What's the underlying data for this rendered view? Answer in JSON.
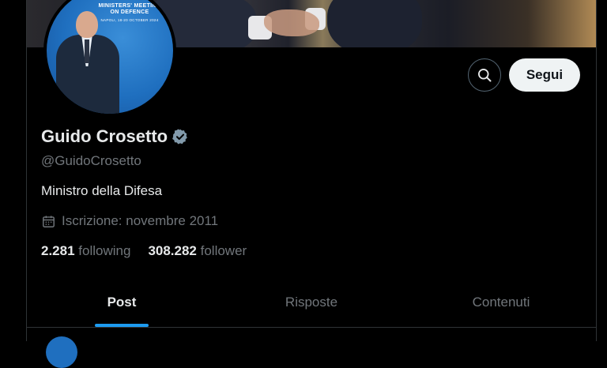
{
  "banner": {
    "avatar_text_line1": "MINISTERS' MEETING",
    "avatar_text_line2": "ON DEFENCE",
    "avatar_text_line3": "NAPOLI, 18-20 OCTOBER 2024"
  },
  "profile": {
    "name": "Guido Crosetto",
    "handle": "@GuidoCrosetto",
    "bio": "Ministro della Difesa",
    "joined": "Iscrizione: novembre 2011",
    "following_count": "2.281",
    "following_label": "following",
    "followers_count": "308.282",
    "followers_label": "follower"
  },
  "actions": {
    "search_icon": "search-icon",
    "follow_label": "Segui"
  },
  "tabs": [
    {
      "label": "Post",
      "active": true
    },
    {
      "label": "Risposte",
      "active": false
    },
    {
      "label": "Contenuti",
      "active": false
    }
  ],
  "colors": {
    "accent": "#1d9bf0",
    "background": "#000000",
    "muted": "#71767b",
    "verified": "#829aab"
  }
}
